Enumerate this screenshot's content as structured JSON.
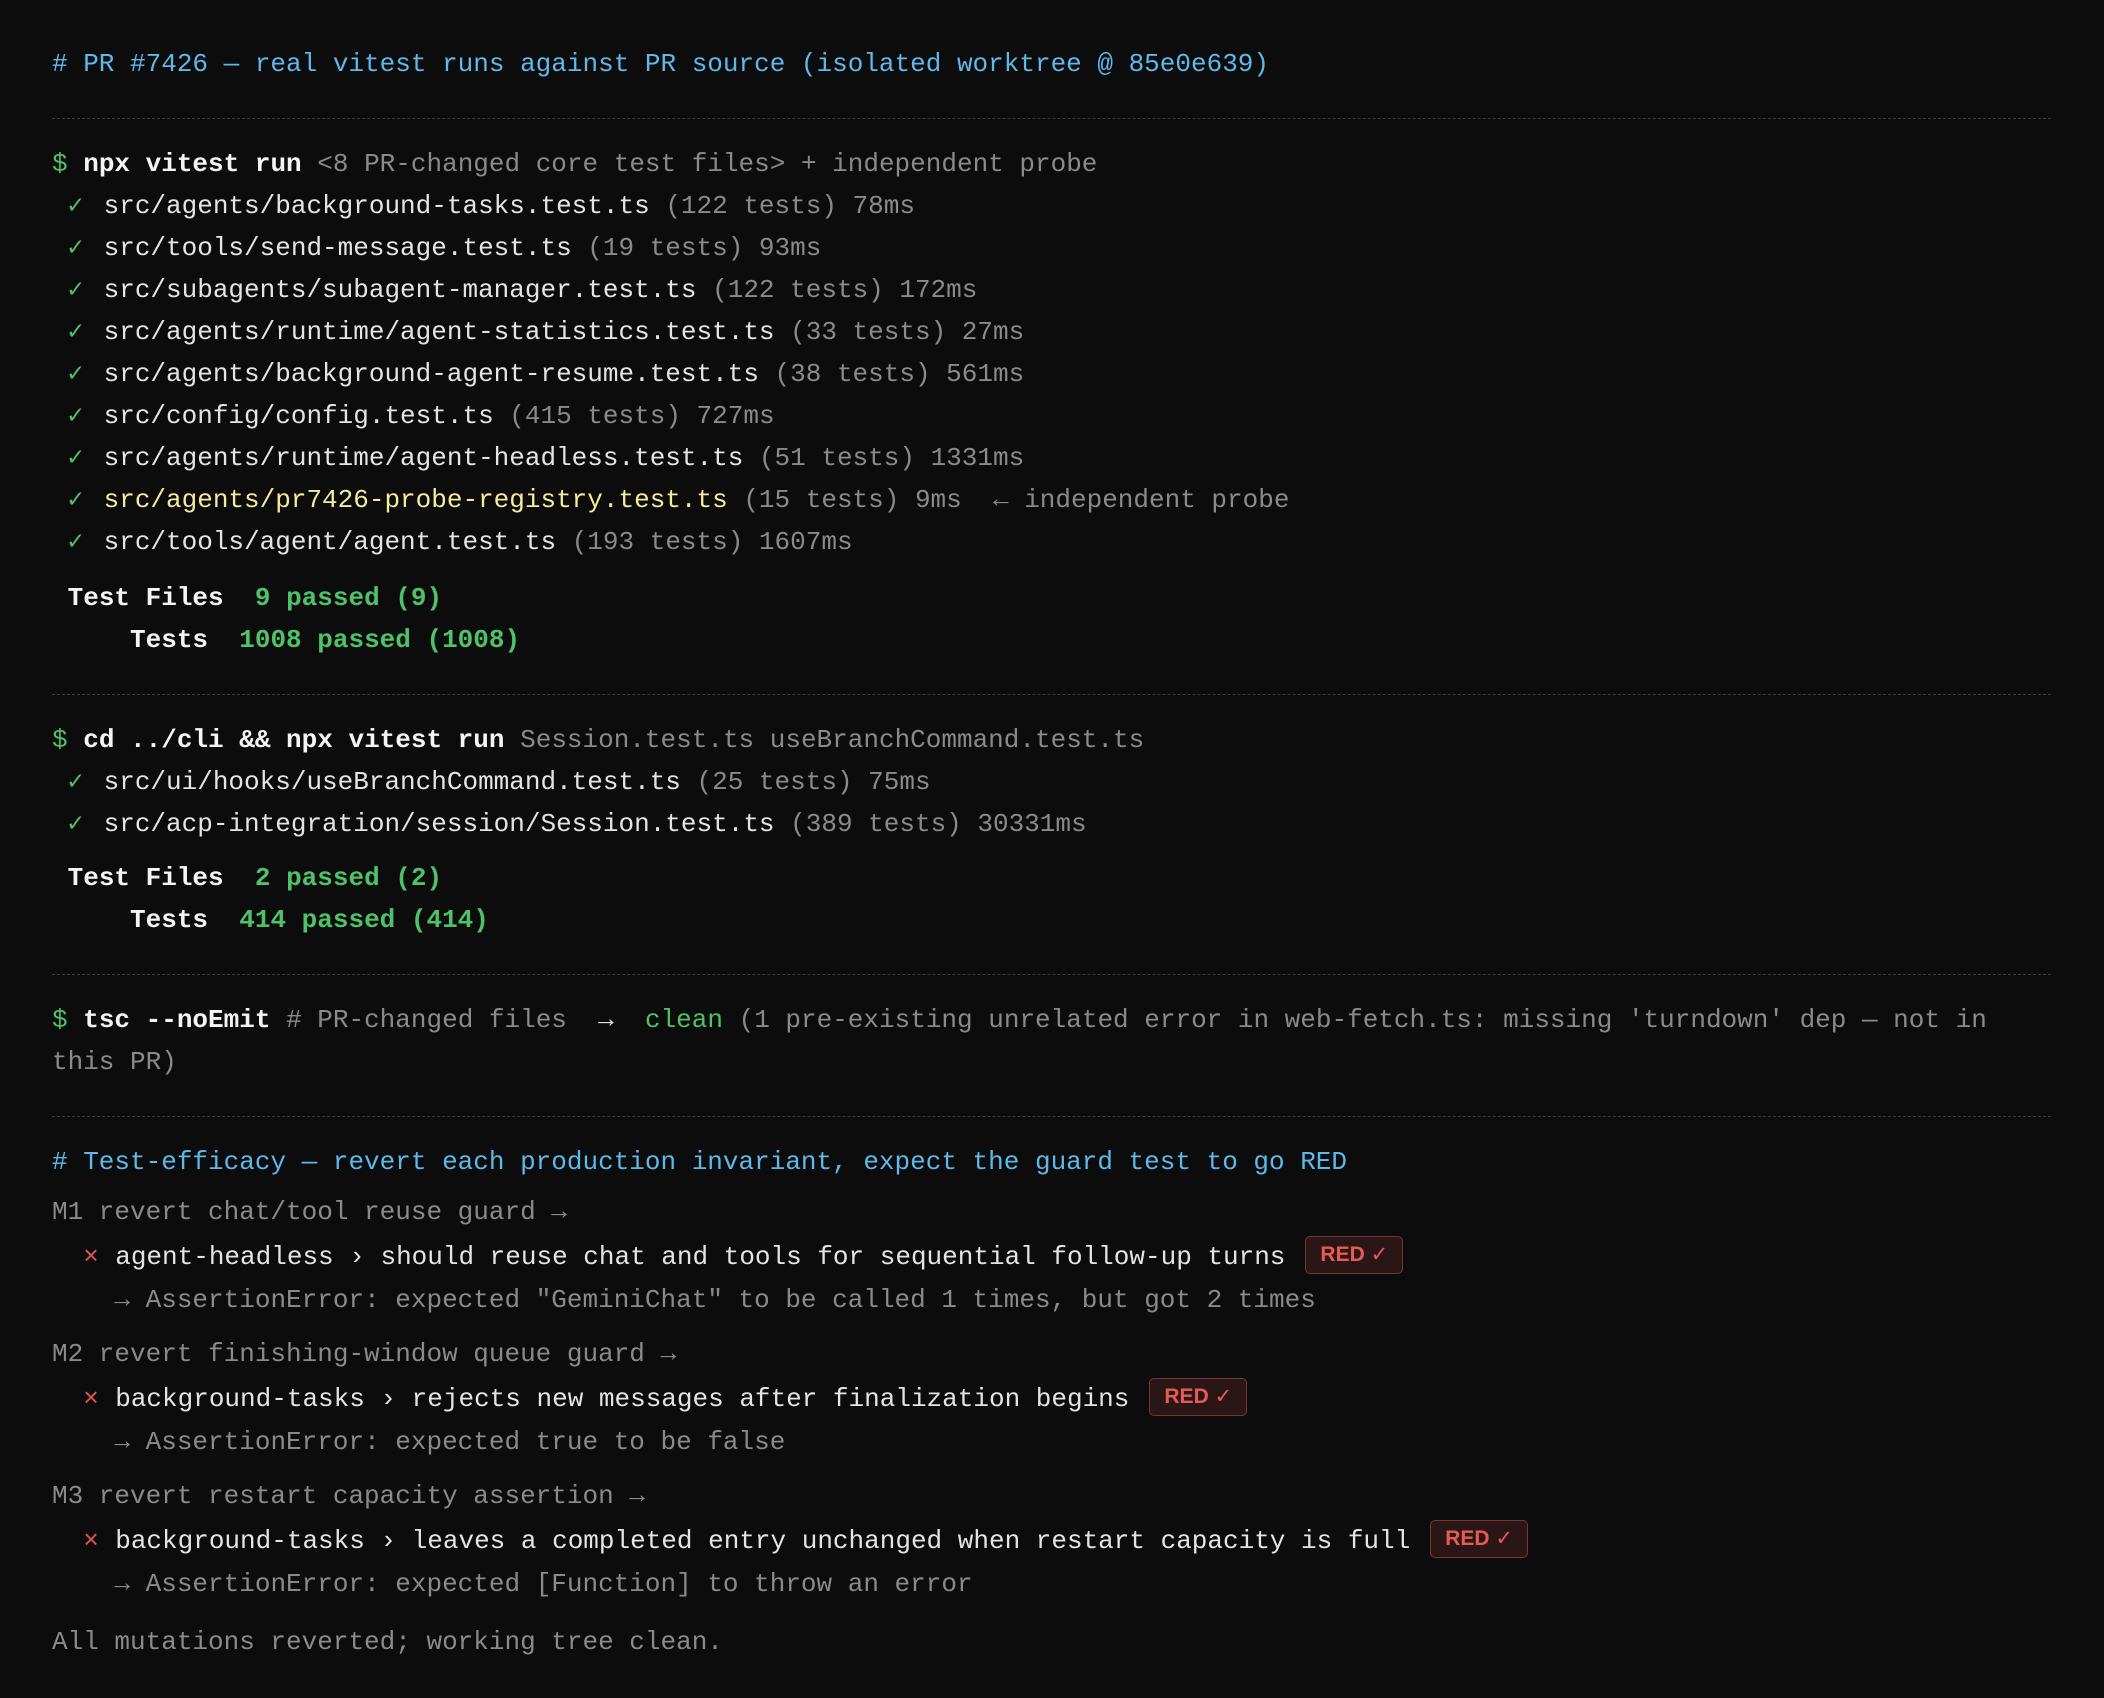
{
  "heading": "# PR #7426 — real vitest runs against PR source (isolated worktree @ 85e0e639)",
  "run1": {
    "prompt": "$",
    "command": "npx vitest run",
    "args": "<8 PR-changed core test files> + independent probe",
    "check_glyph": "✓",
    "files": [
      {
        "path": "src/agents/background-tasks.test.ts",
        "meta": "(122 tests) 78ms",
        "note": ""
      },
      {
        "path": "src/tools/send-message.test.ts",
        "meta": "(19 tests) 93ms",
        "note": ""
      },
      {
        "path": "src/subagents/subagent-manager.test.ts",
        "meta": "(122 tests) 172ms",
        "note": ""
      },
      {
        "path": "src/agents/runtime/agent-statistics.test.ts",
        "meta": "(33 tests) 27ms",
        "note": ""
      },
      {
        "path": "src/agents/background-agent-resume.test.ts",
        "meta": "(38 tests) 561ms",
        "note": ""
      },
      {
        "path": "src/config/config.test.ts",
        "meta": "(415 tests) 727ms",
        "note": ""
      },
      {
        "path": "src/agents/runtime/agent-headless.test.ts",
        "meta": "(51 tests) 1331ms",
        "note": ""
      },
      {
        "path": "src/agents/pr7426-probe-registry.test.ts",
        "meta": "(15 tests) 9ms",
        "note": "← independent probe"
      },
      {
        "path": "src/tools/agent/agent.test.ts",
        "meta": "(193 tests) 1607ms",
        "note": ""
      }
    ],
    "summary": {
      "files_label": "Test Files",
      "files_value": "9 passed (9)",
      "tests_label": "Tests",
      "tests_value": "1008 passed (1008)"
    }
  },
  "run2": {
    "prompt": "$",
    "command": "cd ../cli && npx vitest run",
    "args": "Session.test.ts useBranchCommand.test.ts",
    "files": [
      {
        "path": "src/ui/hooks/useBranchCommand.test.ts",
        "meta": "(25 tests) 75ms"
      },
      {
        "path": "src/acp-integration/session/Session.test.ts",
        "meta": "(389 tests) 30331ms"
      }
    ],
    "summary": {
      "files_label": "Test Files",
      "files_value": "2 passed (2)",
      "tests_label": "Tests",
      "tests_value": "414 passed (414)"
    }
  },
  "tsc": {
    "prompt": "$",
    "command": "tsc --noEmit",
    "comment": "# PR-changed files",
    "arrow": "→",
    "result": "clean",
    "note": "(1 pre-existing unrelated error in web-fetch.ts: missing 'turndown' dep — not in this PR)"
  },
  "efficacy": {
    "heading": "# Test-efficacy — revert each production invariant, expect the guard test to go RED",
    "cross_glyph": "×",
    "badge": "RED ✓",
    "mutations": [
      {
        "title": "M1 revert chat/tool reuse guard →",
        "test": "agent-headless › should reuse chat and tools for sequential follow-up turns",
        "error": "→ AssertionError: expected \"GeminiChat\" to be called 1 times, but got 2 times"
      },
      {
        "title": "M2 revert finishing-window queue guard →",
        "test": "background-tasks › rejects new messages after finalization begins",
        "error": "→ AssertionError: expected true to be false"
      },
      {
        "title": "M3 revert restart capacity assertion →",
        "test": "background-tasks › leaves a completed entry unchanged when restart capacity is full",
        "error": "→ AssertionError: expected [Function] to throw an error"
      }
    ],
    "footer": "All mutations reverted; working tree clean."
  }
}
